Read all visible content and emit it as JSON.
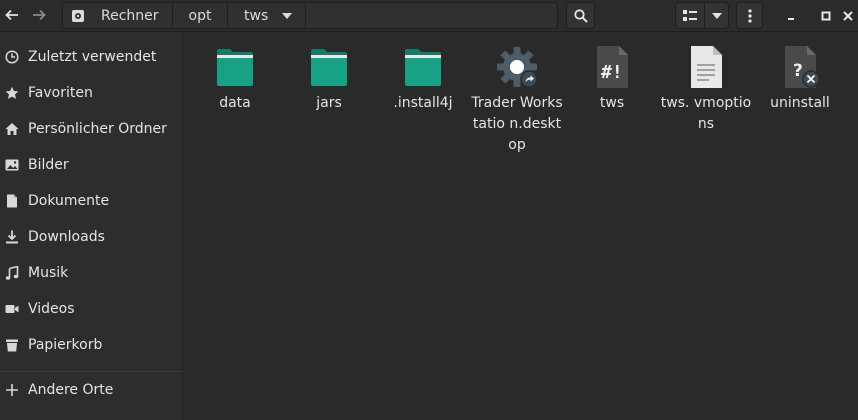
{
  "header": {
    "back_icon": "arrow-left-icon",
    "forward_icon": "arrow-right-icon",
    "breadcrumbs": [
      "Rechner",
      "opt",
      "tws"
    ],
    "search_icon": "search-icon",
    "view_icon": "list-view-icon",
    "menu_icon": "kebab-menu-icon"
  },
  "sidebar": {
    "items": [
      {
        "label": "Zuletzt verwendet",
        "icon": "clock-icon"
      },
      {
        "label": "Favoriten",
        "icon": "star-icon"
      },
      {
        "label": "Persönlicher Ordner",
        "icon": "home-icon"
      },
      {
        "label": "Bilder",
        "icon": "image-icon"
      },
      {
        "label": "Dokumente",
        "icon": "document-icon"
      },
      {
        "label": "Downloads",
        "icon": "download-icon"
      },
      {
        "label": "Musik",
        "icon": "music-icon"
      },
      {
        "label": "Videos",
        "icon": "video-icon"
      },
      {
        "label": "Papierkorb",
        "icon": "trash-icon"
      },
      {
        "label": "Andere Orte",
        "icon": "plus-icon"
      }
    ]
  },
  "files": [
    {
      "name": "data",
      "type": "folder"
    },
    {
      "name": "jars",
      "type": "folder"
    },
    {
      "name": ".install4j",
      "type": "folder"
    },
    {
      "name": "Trader Workstatio n.desktop",
      "type": "desktop"
    },
    {
      "name": "tws",
      "type": "script"
    },
    {
      "name": "tws. vmoptions",
      "type": "text"
    },
    {
      "name": "uninstall",
      "type": "unknown"
    }
  ],
  "colors": {
    "accent": "#16a085",
    "background": "#2a2a2a",
    "sidebar": "#2d2d2d"
  }
}
